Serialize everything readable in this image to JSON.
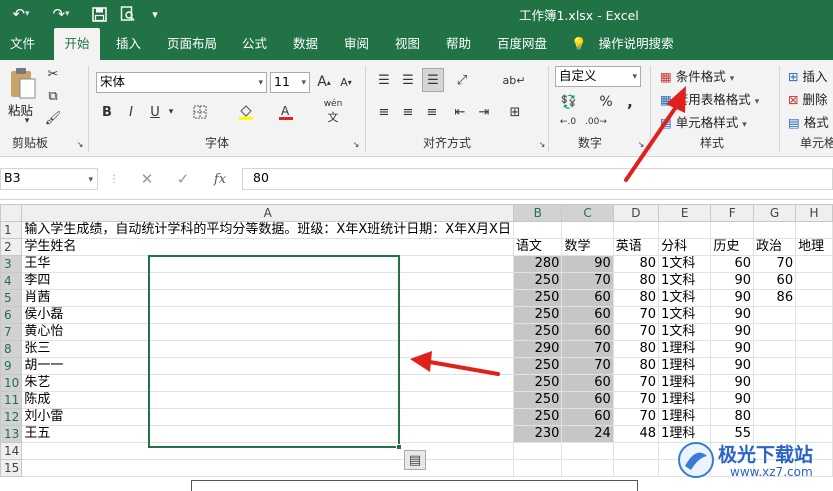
{
  "window": {
    "title": "工作簿1.xlsx  -  Excel"
  },
  "quick_access": {
    "undo_icon": "undo-icon",
    "redo_icon": "redo-icon",
    "save_icon": "save-icon",
    "preview_icon": "print-preview-icon",
    "customize_icon": "customize-qat-icon"
  },
  "tabs": [
    "文件",
    "开始",
    "插入",
    "页面布局",
    "公式",
    "数据",
    "审阅",
    "视图",
    "帮助",
    "百度网盘"
  ],
  "tell_me": "操作说明搜索",
  "ribbon": {
    "clipboard": {
      "label": "剪贴板",
      "paste": "粘贴"
    },
    "font": {
      "label": "字体",
      "name": "宋体",
      "size": "11",
      "bold": "B",
      "italic": "I",
      "underline": "U",
      "grow": "A",
      "shrink": "A",
      "phonetic": "wén"
    },
    "alignment": {
      "label": "对齐方式"
    },
    "number": {
      "label": "数字",
      "format": "自定义"
    },
    "styles": {
      "label": "样式",
      "conditional": "条件格式",
      "table_format": "套用表格格式",
      "cell_styles": "单元格样式"
    },
    "cells": {
      "label": "单元格",
      "insert": "插入",
      "delete": "删除",
      "format": "格式"
    }
  },
  "formula_bar": {
    "name_box": "B3",
    "fx": "fx",
    "value": "80"
  },
  "sheet": {
    "columns": [
      "A",
      "B",
      "C",
      "D",
      "E",
      "F",
      "G",
      "H"
    ],
    "rows": [
      [
        "输入学生成绩，自动统计学科的平均分等数据。班级：X年X班统计日期：X年X月X日",
        "",
        "",
        "",
        "",
        "",
        "",
        ""
      ],
      [
        "学生姓名",
        "语文",
        "数学",
        "英语",
        "分科",
        "历史",
        "政治",
        "地理"
      ],
      [
        "王华",
        "280",
        "90",
        "80",
        "1文科",
        "60",
        "70",
        ""
      ],
      [
        "李四",
        "250",
        "70",
        "80",
        "1文科",
        "90",
        "60",
        ""
      ],
      [
        "肖茜",
        "250",
        "60",
        "80",
        "1文科",
        "90",
        "86",
        ""
      ],
      [
        "侯小磊",
        "250",
        "60",
        "70",
        "1文科",
        "90",
        "",
        ""
      ],
      [
        "黄心怡",
        "250",
        "60",
        "70",
        "1文科",
        "90",
        "",
        ""
      ],
      [
        "张三",
        "290",
        "70",
        "80",
        "1理科",
        "90",
        "",
        ""
      ],
      [
        "胡一一",
        "250",
        "70",
        "80",
        "1理科",
        "90",
        "",
        ""
      ],
      [
        "朱艺",
        "250",
        "60",
        "70",
        "1理科",
        "90",
        "",
        ""
      ],
      [
        "陈成",
        "250",
        "60",
        "70",
        "1理科",
        "90",
        "",
        ""
      ],
      [
        "刘小雷",
        "250",
        "60",
        "70",
        "1理科",
        "80",
        "",
        ""
      ],
      [
        "王五",
        "230",
        "24",
        "48",
        "1理科",
        "55",
        "",
        ""
      ],
      [
        "",
        "",
        "",
        "",
        "",
        "",
        "",
        ""
      ],
      [
        "",
        "",
        "",
        "",
        "",
        "",
        "",
        ""
      ]
    ]
  },
  "watermark": {
    "brand": "极光下载站",
    "url": "www.xz7.com"
  },
  "colors": {
    "accent": "#217346",
    "annotation_arrow": "#e0201b",
    "selection": "#c6c6c6"
  }
}
